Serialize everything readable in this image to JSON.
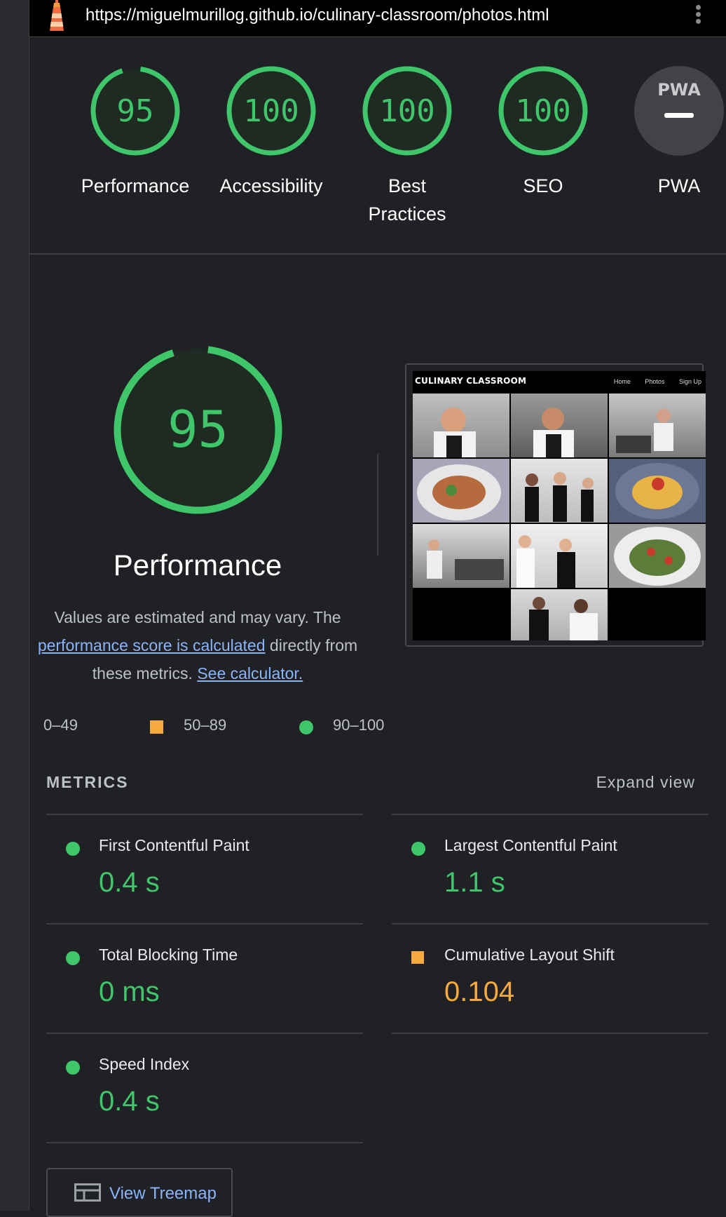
{
  "browser": {
    "url": "https://miguelmurillog.github.io/culinary-classroom/photos.html",
    "logo_icon": "lighthouse-icon",
    "menu_icon": "kebab-menu-icon"
  },
  "scores": [
    {
      "label": "Performance",
      "value": "95",
      "fraction": 0.95,
      "color": "#3fc56a"
    },
    {
      "label": "Accessibility",
      "value": "100",
      "fraction": 1.0,
      "color": "#3fc56a"
    },
    {
      "label": "Best Practices",
      "value": "100",
      "fraction": 1.0,
      "color": "#3fc56a"
    },
    {
      "label": "SEO",
      "value": "100",
      "fraction": 1.0,
      "color": "#3fc56a"
    },
    {
      "label": "PWA",
      "value": "PWA",
      "color": "#9aa0a6"
    }
  ],
  "performance": {
    "score": "95",
    "fraction": 0.95,
    "title": "Performance",
    "desc_part1": "Values are estimated and may vary. The",
    "desc_link1": "performance score is calculated",
    "desc_part2": "directly from these metrics.",
    "desc_link2": "See calculator."
  },
  "screenshot": {
    "brand": "CULINARY CLASSROOM",
    "nav": [
      "Home",
      "Photos",
      "Sign Up"
    ]
  },
  "legend": {
    "fail": "0–49",
    "average": "50–89",
    "pass": "90–100",
    "colors": {
      "fail": "#ff4e42",
      "average": "#f5a93f",
      "pass": "#3fc56a"
    }
  },
  "metrics": {
    "header": "METRICS",
    "expand": "Expand view",
    "items": [
      {
        "name": "First Contentful Paint",
        "value": "0.4 s",
        "status": "pass"
      },
      {
        "name": "Largest Contentful Paint",
        "value": "1.1 s",
        "status": "pass"
      },
      {
        "name": "Total Blocking Time",
        "value": "0 ms",
        "status": "pass"
      },
      {
        "name": "Cumulative Layout Shift",
        "value": "0.104",
        "status": "average"
      },
      {
        "name": "Speed Index",
        "value": "0.4 s",
        "status": "pass"
      }
    ]
  },
  "treemap": {
    "label": "View Treemap",
    "icon": "treemap-icon"
  }
}
